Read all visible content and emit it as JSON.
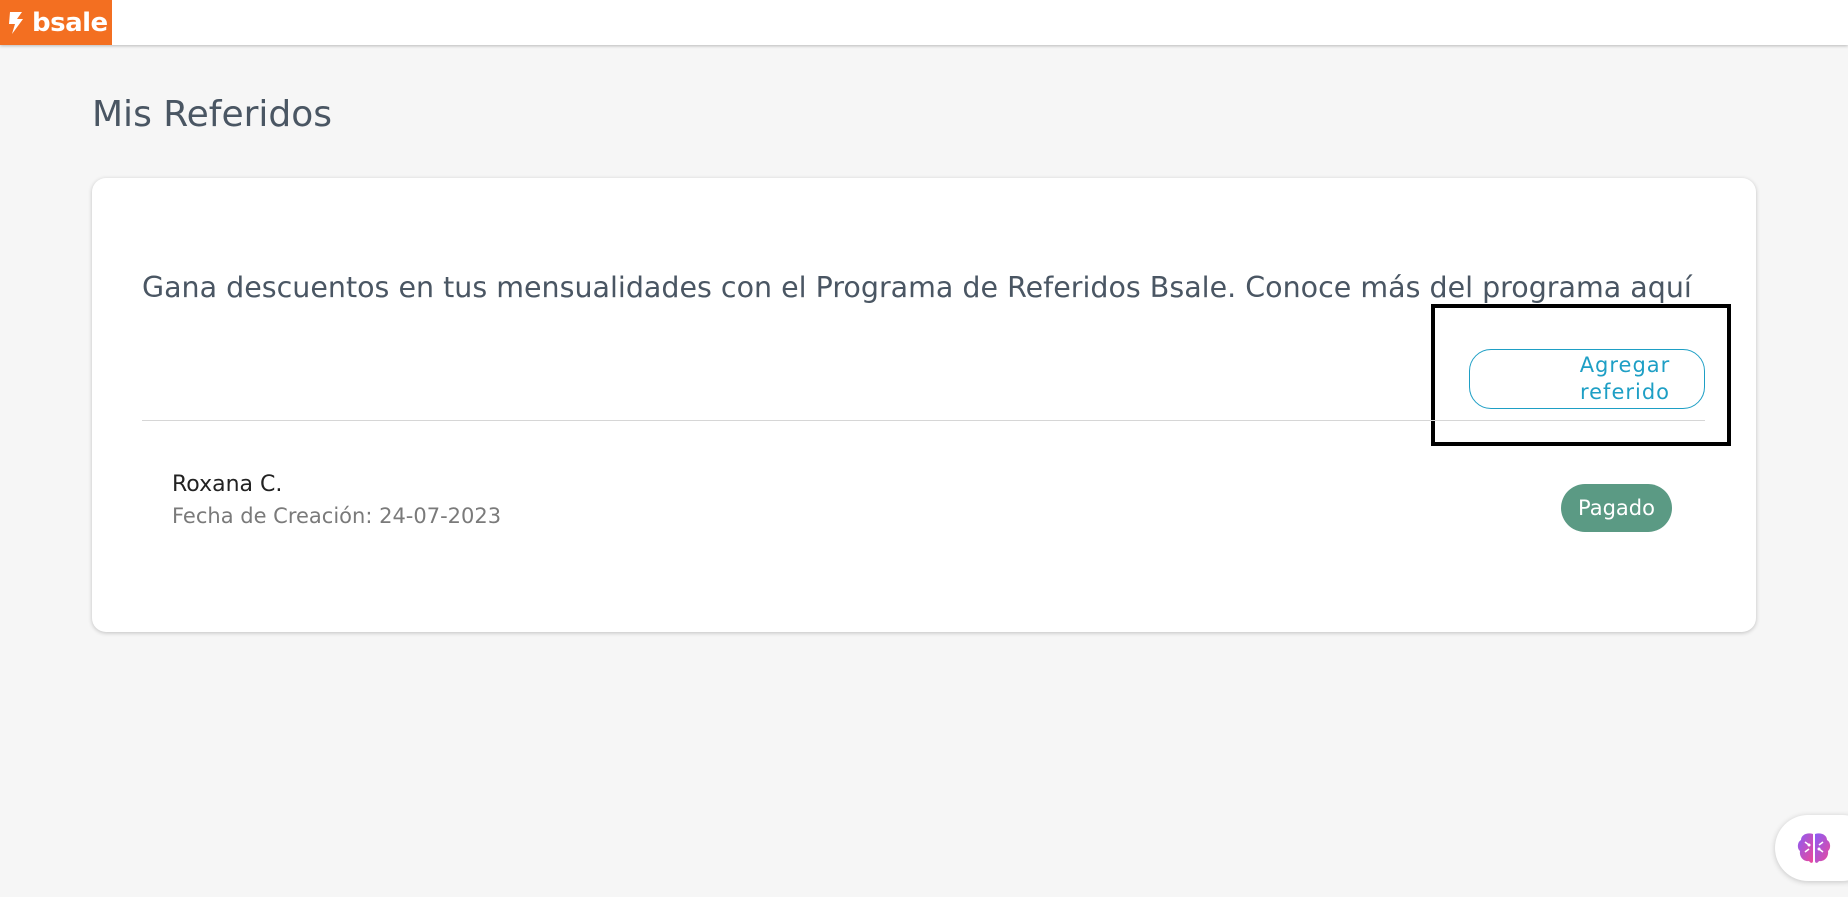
{
  "header": {
    "brand": "bsale",
    "logo_color": "#f36f21"
  },
  "page": {
    "title": "Mis Referidos"
  },
  "card": {
    "promo_text": "Gana descuentos en tus mensualidades con el Programa de Referidos Bsale. Conoce más del programa ",
    "promo_link": "aquí",
    "add_button_line1": "Agregar",
    "add_button_line2": "referido",
    "accent_color": "#1e9fc5"
  },
  "referrals": [
    {
      "name": "Roxana C.",
      "date_label": "Fecha de Creación: 24-07-2023",
      "status": "Pagado",
      "status_color": "#5b9a84"
    }
  ],
  "assistant": {
    "icon": "brain-icon"
  }
}
